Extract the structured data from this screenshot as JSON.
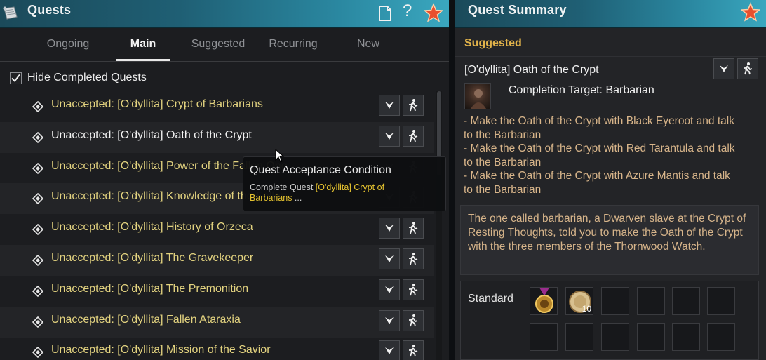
{
  "quests_window": {
    "title": "Quests",
    "icons": [
      "scroll-icon",
      "document-icon",
      "help-icon",
      "favorite-star-icon"
    ],
    "help_glyph": "?",
    "tabs": [
      {
        "label": "Ongoing",
        "active": false
      },
      {
        "label": "Main",
        "active": true
      },
      {
        "label": "Suggested",
        "active": false
      },
      {
        "label": "Recurring",
        "active": false
      },
      {
        "label": "New",
        "active": false
      }
    ],
    "hide_completed": {
      "label": "Hide Completed Quests",
      "checked": true
    },
    "quests": [
      {
        "text": "Unaccepted: [O'dyllita] Crypt of Barbarians",
        "color": "#e2d27f"
      },
      {
        "text": "Unaccepted: [O'dyllita] Oath of the Crypt",
        "color": "#f3f3f3"
      },
      {
        "text": "Unaccepted: [O'dyllita] Power of the Fallen One",
        "color": "#e2d27f"
      },
      {
        "text": "Unaccepted: [O'dyllita] Knowledge of the Fallen",
        "color": "#e2d27f"
      },
      {
        "text": "Unaccepted: [O'dyllita] History of Orzeca",
        "color": "#e2d27f"
      },
      {
        "text": "Unaccepted: [O'dyllita] The Gravekeeper",
        "color": "#e2d27f"
      },
      {
        "text": "Unaccepted: [O'dyllita] The Premonition",
        "color": "#e2d27f"
      },
      {
        "text": "Unaccepted: [O'dyllita] Fallen Ataraxia",
        "color": "#e2d27f"
      },
      {
        "text": "Unaccepted: [O'dyllita] Mission of the Savior",
        "color": "#e2d27f"
      }
    ],
    "tooltip": {
      "title": "Quest Acceptance Condition",
      "body_prefix": "Complete Quest ",
      "body_quest": "[O'dyllita] Crypt of Barbarians",
      "body_suffix": " ..."
    }
  },
  "summary_window": {
    "title": "Quest Summary",
    "category": "Suggested",
    "quest_title": "[O'dyllita] Oath of the Crypt",
    "completion_target": "Completion Target: Barbarian",
    "objectives": [
      "- Make the Oath of the Crypt with Black Eyeroot and talk to the Barbarian",
      "- Make the Oath of the Crypt with Red Tarantula and talk to the Barbarian",
      "- Make the Oath of the Crypt with Azure Mantis and talk to the Barbarian"
    ],
    "description": "The one called barbarian, a Dwarven slave at the Crypt of Resting Thoughts, told you to make the Oath of the Crypt with the three members of the Thornwood Watch.",
    "rewards": {
      "label": "Standard",
      "items": [
        {
          "icon": "medal-icon",
          "count": ""
        },
        {
          "icon": "contribution-coin-icon",
          "count": "10"
        }
      ],
      "empty_slots": 10
    }
  },
  "colors": {
    "quest_yellow": "#e2d27f",
    "objective_tan": "#d8b58a",
    "category_gold": "#e0b24a",
    "title_bar": "#1f5f74"
  }
}
